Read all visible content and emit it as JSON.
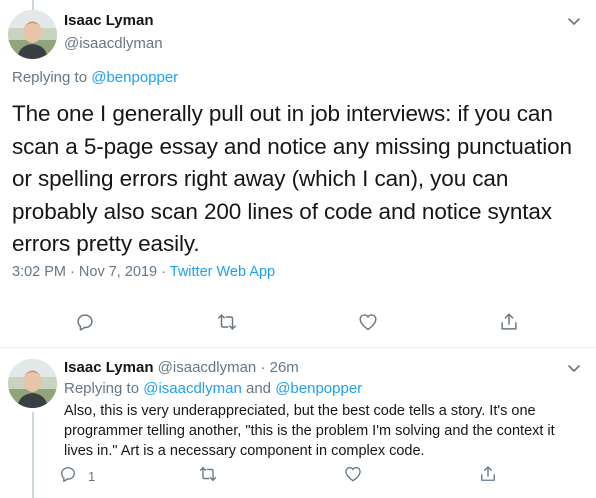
{
  "main_tweet": {
    "author_name": "Isaac Lyman",
    "author_handle": "@isaacdlyman",
    "replying_prefix": "Replying to ",
    "replying_to": "@benpopper",
    "text": "The one I generally pull out in job interviews: if you can scan a 5-page essay and notice any missing punctuation or spelling errors right away (which I can), you can probably also scan 200 lines of code and notice syntax errors pretty easily.",
    "time": "3:02 PM",
    "date": "Nov 7, 2019",
    "separator": "·",
    "client": "Twitter Web App",
    "actions": [
      "reply-icon",
      "retweet-icon",
      "like-icon",
      "share-icon"
    ]
  },
  "reply_tweet": {
    "author_name": "Isaac Lyman",
    "author_handle": "@isaacdlyman",
    "dot": "·",
    "time_ago": "26m",
    "replying_prefix": "Replying to ",
    "replying_to_1": "@isaacdlyman",
    "replying_and": " and ",
    "replying_to_2": "@benpopper",
    "text": "Also, this is very underappreciated, but the best code tells a story. It's one programmer telling another, \"this is the problem I'm solving and the context it lives in.\" Art is a necessary component in complex code.",
    "reply_count": "1"
  },
  "colors": {
    "link": "#1da1f2",
    "secondary": "#657786",
    "primary_text": "#14171a",
    "divider": "#e6ecf0",
    "thread_line": "#ccd6dd"
  }
}
